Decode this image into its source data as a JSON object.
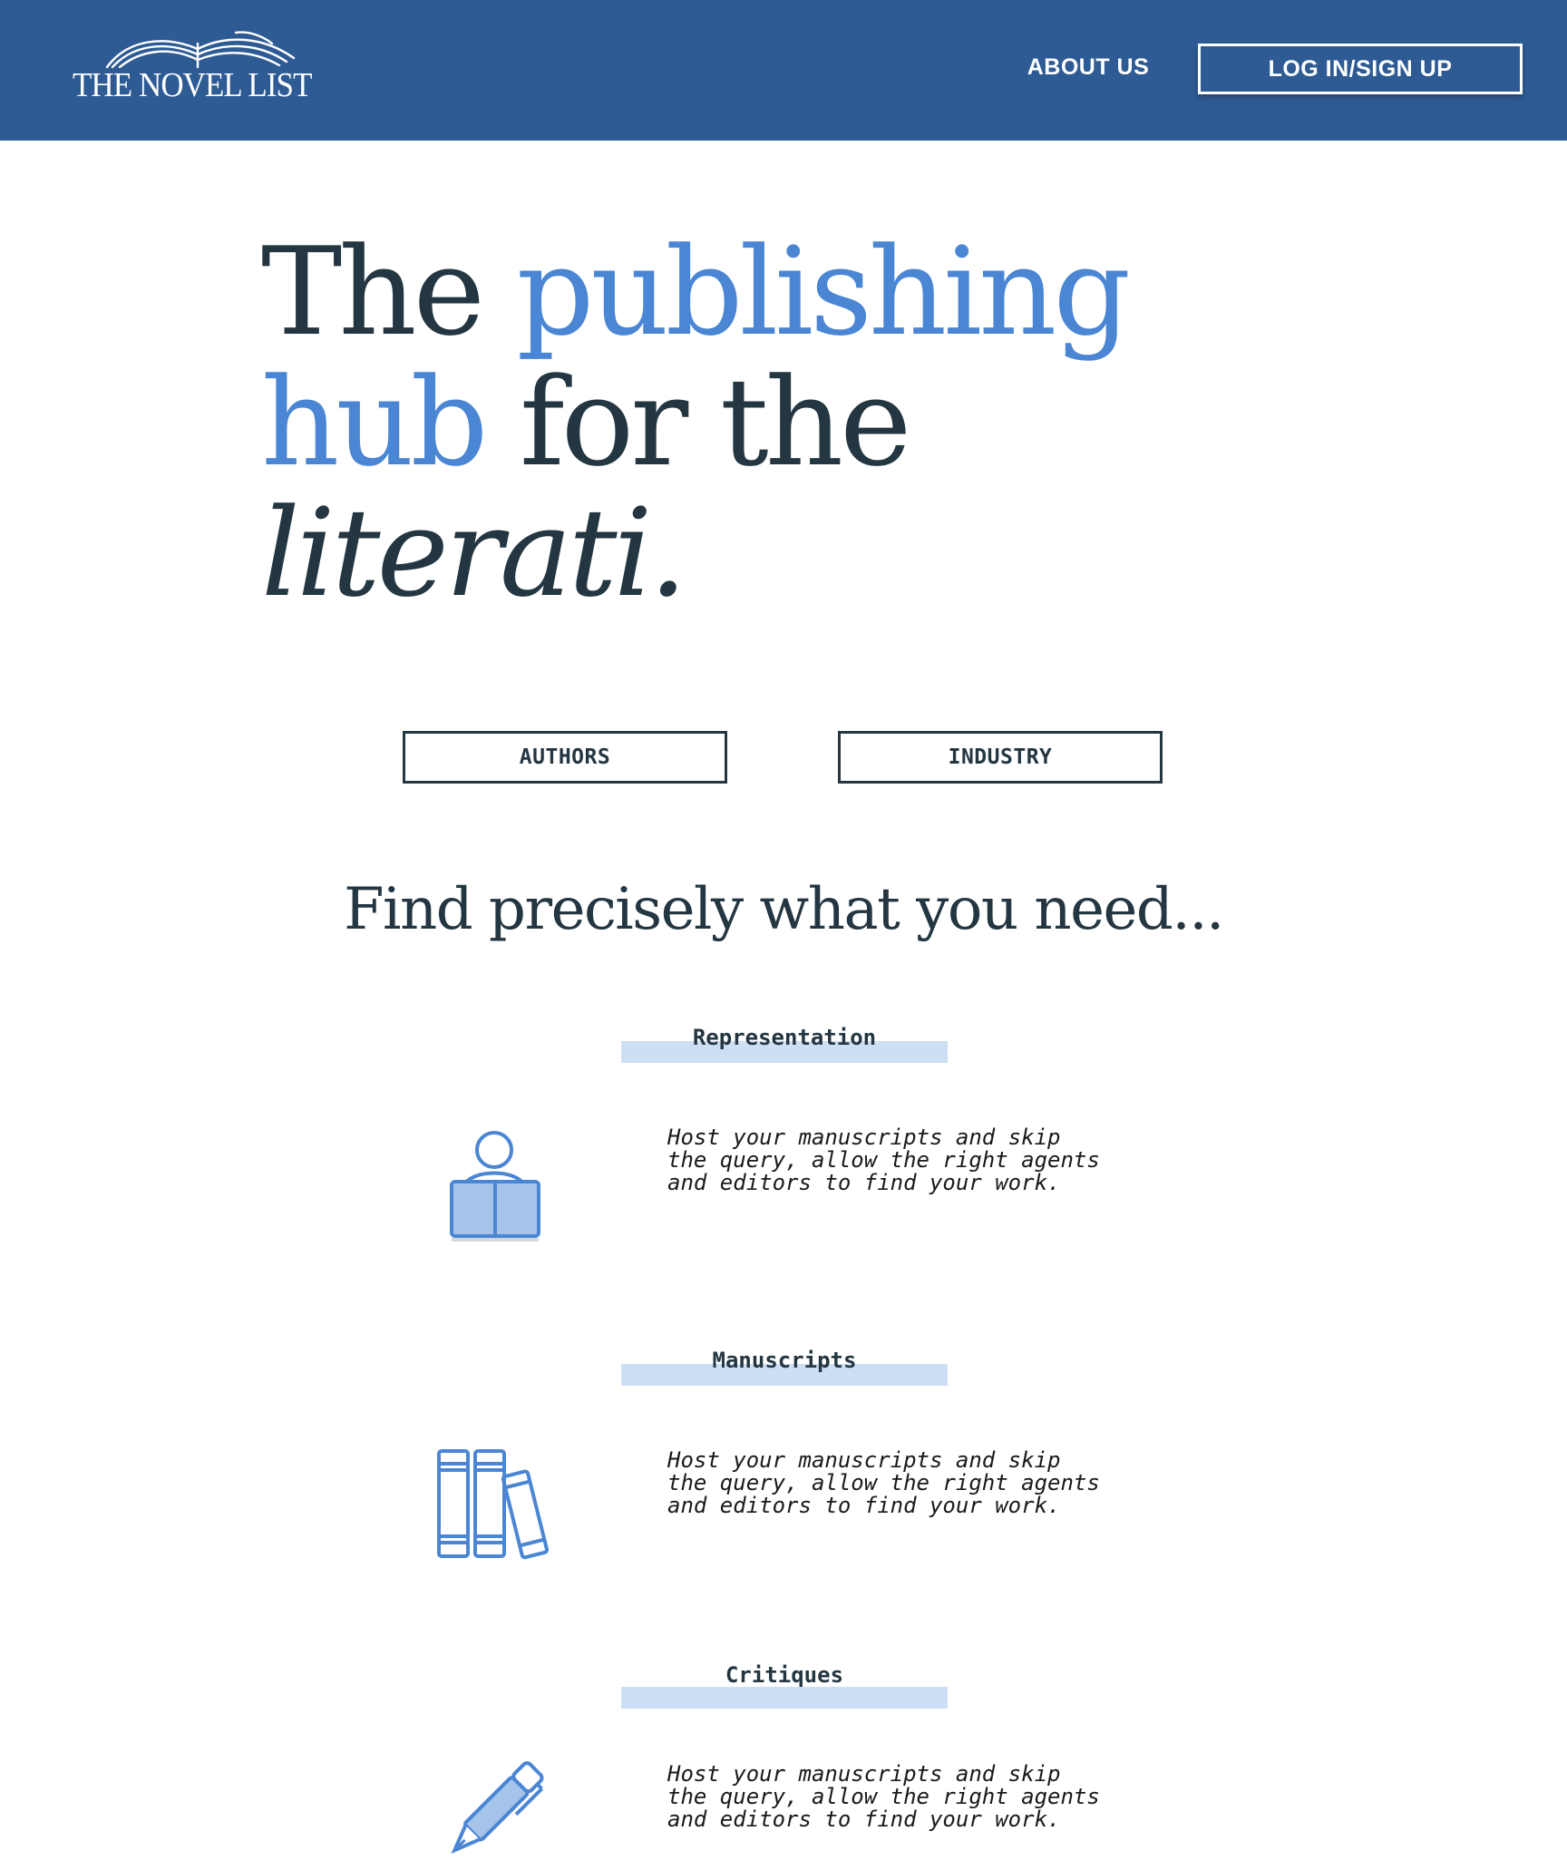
{
  "header": {
    "logo_text": "THE NOVEL LIST",
    "nav": {
      "about_label": "ABOUT US",
      "login_label": "LOG IN/SIGN UP"
    }
  },
  "hero": {
    "line1_a": "The ",
    "line1_b": "publishing",
    "line2_a": "hub",
    "line2_b": " for the",
    "line3": "literati."
  },
  "audience": {
    "authors_label": "AUTHORS",
    "industry_label": "INDUSTRY"
  },
  "features_title": "Find precisely what you need...",
  "features": [
    {
      "title": "Representation",
      "icon": "reader-book-icon",
      "description": "Host your manuscripts and skip the query, allow the right agents and editors to find your work."
    },
    {
      "title": "Manuscripts",
      "icon": "books-icon",
      "description": "Host your manuscripts and skip the query, allow the right agents and editors to find your work."
    },
    {
      "title": "Critiques",
      "icon": "pen-icon",
      "description": "Host your manuscripts and skip the query, allow the right agents and editors to find your work."
    }
  ],
  "colors": {
    "header_bg": "#2e5b94",
    "accent_blue": "#4a86d4",
    "dark_text": "#233641",
    "label_highlight": "#cddff4"
  }
}
